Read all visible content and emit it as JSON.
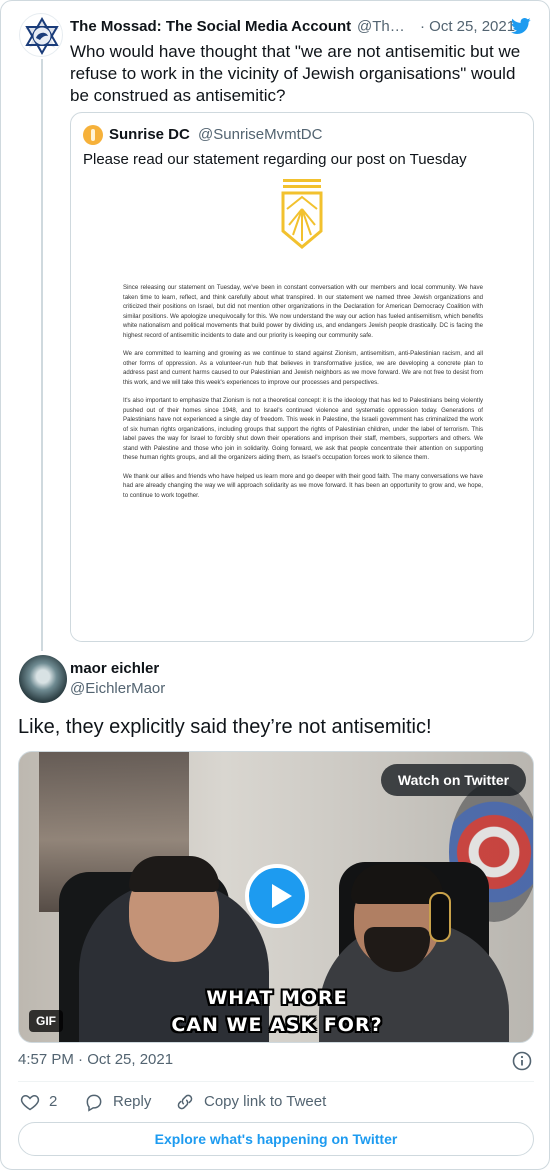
{
  "parent_tweet": {
    "author_name": "The Mossad: The Social Media Account",
    "author_handle": "@Th…",
    "date": "Oct 25, 2021",
    "text": "Who would have thought that \"we are not antisemitic but we refuse to work in the vicinity of Jewish organisations\" would be construed as antisemitic?",
    "quoted": {
      "author_name": "Sunrise DC",
      "author_handle": "@SunriseMvmtDC",
      "text": "Please read our statement regarding our post on Tuesday",
      "statement_paragraphs": [
        "Since releasing our statement on Tuesday, we've been in constant conversation with our members and local community. We have taken time to learn, reflect, and think carefully about what transpired. In our statement we named three Jewish organizations and criticized their positions on Israel, but did not mention other organizations in the Declaration for American Democracy Coalition with similar positions. We apologize unequivocally for this. We now understand the way our action has fueled antisemitism, which benefits white nationalism and political movements that build power by dividing us, and endangers Jewish people drastically. DC is facing the highest record of antisemitic incidents to date and our priority is keeping our community safe.",
        "We are committed to learning and growing as we continue to stand against Zionism, antisemitism, anti-Palestinian racism, and all other forms of oppression. As a volunteer-run hub that believes in transformative justice, we are developing a concrete plan to address past and current harms caused to our Palestinian and Jewish neighbors as we move forward. We are not free to desist from this work, and we will take this week's experiences to improve our processes and perspectives.",
        "It's also important to emphasize that Zionism is not a theoretical concept: it is the ideology that has led to Palestinians being violently pushed out of their homes since 1948, and to Israel's continued violence and systematic oppression today. Generations of Palestinians have not experienced a single day of freedom. This week in Palestine, the Israeli government has criminalized the work of six human rights organizations, including groups that support the rights of Palestinian children, under the label of terrorism. This label paves the way for Israel to forcibly shut down their operations and imprison their staff, members, supporters and others. We stand with Palestine and those who join in solidarity. Going forward, we ask that people concentrate their attention on supporting these human rights groups, and all the organizers aiding them, as Israel's occupation forces work to silence them.",
        "We thank our allies and friends who have helped us learn more and go deeper with their good faith. The many conversations we have had are already changing the way we will approach solidarity as we move forward. It has been an opportunity to grow and, we hope, to continue to work together."
      ]
    }
  },
  "reply_tweet": {
    "author_name": "maor eichler",
    "author_handle": "@EichlerMaor",
    "text": "Like, they explicitly said they’re not antisemitic!",
    "media": {
      "watch_label": "Watch on Twitter",
      "caption_line1": "WHAT MORE",
      "caption_line2": "CAN WE ASK FOR?",
      "badge": "GIF"
    },
    "timestamp": "4:57 PM · Oct 25, 2021",
    "actions": {
      "like_count": "2",
      "reply_label": "Reply",
      "copy_label": "Copy link to Tweet"
    },
    "explore_label": "Explore what's happening on Twitter"
  },
  "colors": {
    "twitter_blue": "#1d9bf0",
    "secondary_text": "#536471",
    "border": "#cfd9de",
    "sunrise_gold": "#f2c12e"
  },
  "icons": [
    "twitter-bird-icon",
    "play-icon",
    "info-icon",
    "heart-icon",
    "reply-icon",
    "link-icon"
  ]
}
